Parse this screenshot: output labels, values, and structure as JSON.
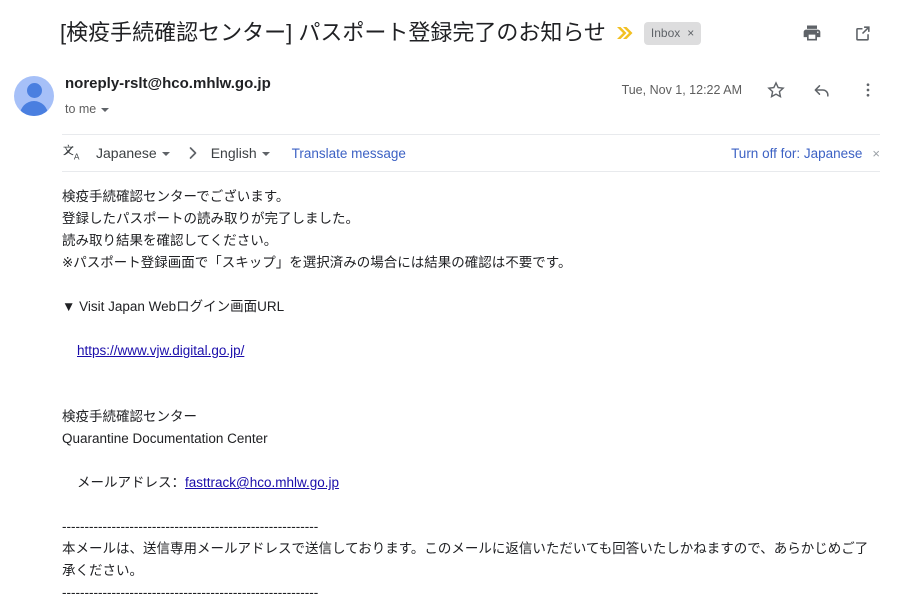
{
  "header": {
    "subject": "[検疫手続確認センター] パスポート登録完了のお知らせ",
    "important_marker_icon": "double-chevron-important-icon",
    "label_chip": "Inbox",
    "label_chip_remove": "×",
    "print_icon": "print-icon",
    "popout_icon": "open-in-new-window-icon"
  },
  "sender": {
    "email": "noreply-rslt@hco.mhlw.go.jp",
    "recipient": "to me",
    "timestamp": "Tue, Nov 1, 12:22 AM",
    "star_icon": "star-icon",
    "reply_icon": "reply-icon",
    "more_icon": "more-vertical-icon",
    "avatar_icon": "avatar-person-icon"
  },
  "translate": {
    "icon": "translate-icon",
    "source_language": "Japanese",
    "arrow": "›",
    "target_language": "English",
    "action_label": "Translate message",
    "turn_off_label": "Turn off for: Japanese",
    "close": "×"
  },
  "body": {
    "line1": "検疫手続確認センターでございます。",
    "line2": "登録したパスポートの読み取りが完了しました。",
    "line3": "読み取り結果を確認してください。",
    "line4": "※パスポート登録画面で「スキップ」を選択済みの場合には結果の確認は不要です。",
    "url_heading": "▼ Visit Japan Webログイン画面URL",
    "url_link": "https://www.vjw.digital.go.jp/",
    "sig_jp": "検疫手続確認センター",
    "sig_en": "Quarantine Documentation Center",
    "sig_mail_label": "メールアドレス：",
    "sig_mail_link": "fasttrack@hco.mhlw.go.jp",
    "separator_top": "---------------------------------------------------------",
    "footer_text": "本メールは、送信専用メールアドレスで送信しております。このメールに返信いただいても回答いたしかねますので、あらかじめご了承ください。",
    "separator_bottom": "---------------------------------------------------------"
  },
  "colors": {
    "accent_link": "#1a0dab",
    "translate_link": "#3d62c4",
    "important_marker": "#f2c022",
    "avatar_bg": "#a6c0f8",
    "avatar_fg": "#4a7fe0",
    "chip_bg": "#ddddde"
  }
}
